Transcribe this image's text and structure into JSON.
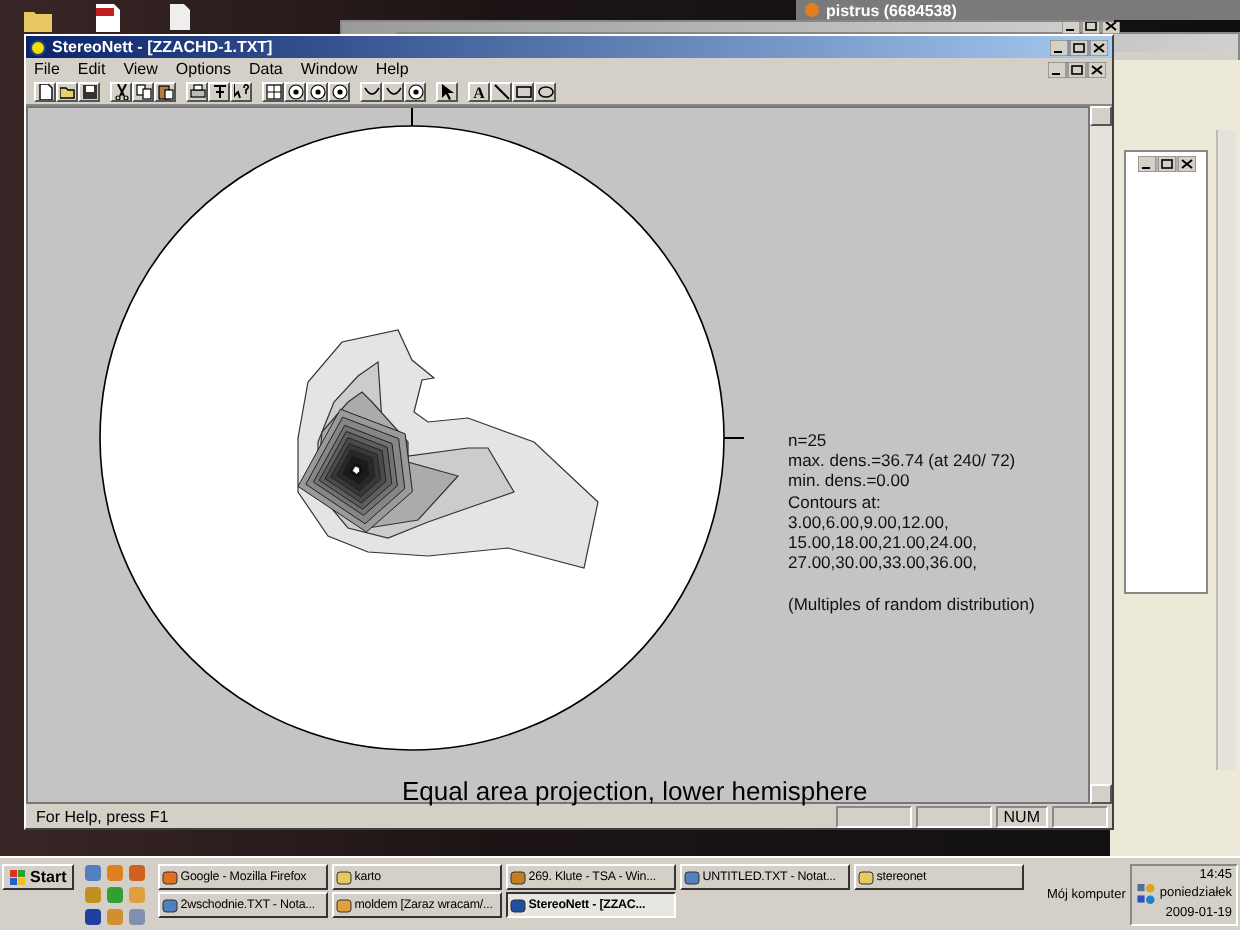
{
  "background_window": {
    "title": "pistrus (6684538)"
  },
  "main_window": {
    "title": "StereoNett - [ZZACHD-1.TXT]",
    "menu": [
      "File",
      "Edit",
      "View",
      "Options",
      "Data",
      "Window",
      "Help"
    ],
    "toolbar": [
      {
        "kind": "new"
      },
      {
        "kind": "open"
      },
      {
        "kind": "save"
      },
      {
        "kind": "sep"
      },
      {
        "kind": "cut"
      },
      {
        "kind": "copy"
      },
      {
        "kind": "paste"
      },
      {
        "kind": "sep"
      },
      {
        "kind": "print"
      },
      {
        "kind": "pin"
      },
      {
        "kind": "help"
      },
      {
        "kind": "sep"
      },
      {
        "kind": "grid"
      },
      {
        "kind": "net"
      },
      {
        "kind": "net"
      },
      {
        "kind": "net"
      },
      {
        "kind": "sep"
      },
      {
        "kind": "arc"
      },
      {
        "kind": "arc"
      },
      {
        "kind": "net"
      },
      {
        "kind": "sep"
      },
      {
        "kind": "pointer"
      },
      {
        "kind": "sep"
      },
      {
        "kind": "text",
        "label": "A"
      },
      {
        "kind": "line"
      },
      {
        "kind": "rect"
      },
      {
        "kind": "ellipse"
      }
    ],
    "plot": {
      "stats": [
        "n=25",
        "max. dens.=36.74 (at 240/ 72)",
        "min. dens.=0.00",
        "Contours at:",
        "3.00,6.00,9.00,12.00,",
        "15.00,18.00,21.00,24.00,",
        "27.00,30.00,33.00,36.00,"
      ],
      "note": "(Multiples of random distribution)",
      "caption": "Equal area projection, lower hemisphere"
    },
    "status_bar": {
      "help": "For Help, press F1",
      "num": "NUM"
    }
  },
  "taskbar": {
    "start": "Start",
    "tasks": [
      {
        "label": "Google - Mozilla Firefox",
        "selected": false
      },
      {
        "label": "karto",
        "selected": false
      },
      {
        "label": "269. Klute - TSA - Win...",
        "selected": false
      },
      {
        "label": "UNTITLED.TXT - Notat...",
        "selected": false
      },
      {
        "label": "stereonet",
        "selected": false
      },
      {
        "label": "2wschodnie.TXT - Nota...",
        "selected": false
      },
      {
        "label": "moldem [Zaraz wracam/...",
        "selected": false
      },
      {
        "label": "StereoNett - [ZZAC...",
        "selected": true
      }
    ],
    "desktop_label": "Mój komputer",
    "clock": {
      "time": "14:45",
      "day": "poniedziałek",
      "date": "2009-01-19"
    }
  }
}
